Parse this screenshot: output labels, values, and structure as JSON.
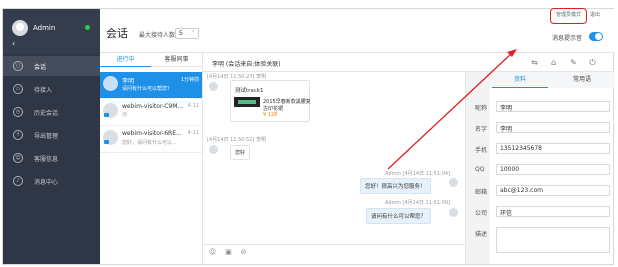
{
  "app": {
    "user_name": "Admin",
    "back_icon": "chevron-left-icon",
    "online_color": "#2ecc40"
  },
  "nav": [
    {
      "label": "会话",
      "icon": "chat-icon"
    },
    {
      "label": "待接入",
      "icon": "inbox-icon"
    },
    {
      "label": "历史会话",
      "icon": "history-icon"
    },
    {
      "label": "导出管理",
      "icon": "export-icon"
    },
    {
      "label": "客服信息",
      "icon": "agent-icon"
    },
    {
      "label": "消息中心",
      "icon": "bell-icon"
    }
  ],
  "header": {
    "title": "会话",
    "max_label": "最大接待人数",
    "max_value": "5",
    "admin_mode": "管理员模式",
    "logout": "退出",
    "notify_label": "消息提示音"
  },
  "list": {
    "tabs": [
      "进行中",
      "客服同事"
    ],
    "items": [
      {
        "name": "李明",
        "time": "1分钟前",
        "message": "请问有什么可以帮您？",
        "active": true
      },
      {
        "name": "webim-visitor-C9M...",
        "time": "4-11",
        "message": "😐",
        "active": false
      },
      {
        "name": "webim-visitor-6RE...",
        "time": "4-11",
        "message": "您好，请问有什么可以...",
        "active": false
      }
    ]
  },
  "chat": {
    "header_text": "李明 (会话来自:体验关联)",
    "tool_icons": [
      "transfer-icon",
      "tag-icon",
      "note-icon",
      "power-icon"
    ],
    "messages": [
      {
        "meta": "[4月14日 11:50:27] 李明",
        "card_title": "测试track1",
        "card_desc_1": "2015早春新款黑腰复",
        "card_desc_2": "古印花裙",
        "card_price": "¥ 128"
      },
      {
        "meta": "[4月14日 11:50:52] 李明",
        "text": "您好"
      },
      {
        "meta": "Admin [4月14日 11:51:04]",
        "text": "您好！很高兴为您服务！"
      },
      {
        "meta": "Admin [4月14日 11:51:09]",
        "text": "请问有什么可以帮您？"
      }
    ],
    "input_icons": [
      "emoji-icon",
      "image-icon",
      "attachment-icon"
    ]
  },
  "profile": {
    "tabs": [
      "资料",
      "常用语"
    ],
    "fields": [
      {
        "label": "昵称",
        "value": "李明"
      },
      {
        "label": "名字",
        "value": "李明"
      },
      {
        "label": "手机",
        "value": "13512345678"
      },
      {
        "label": "QQ",
        "value": "10000"
      },
      {
        "label": "邮箱",
        "value": "abc@123.com"
      },
      {
        "label": "公司",
        "value": "环信"
      },
      {
        "label": "描述",
        "value": ""
      }
    ]
  },
  "colors": {
    "accent": "#1e90e8",
    "sidebar": "#2f3645",
    "annotation": "#e02020"
  }
}
